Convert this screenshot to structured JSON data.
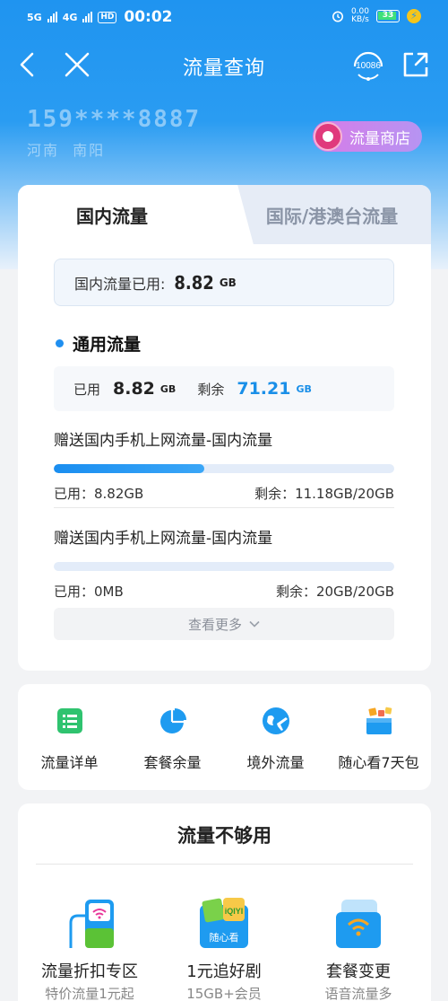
{
  "status_bar": {
    "net1": "5G",
    "net2": "4G",
    "hd": "HD",
    "time": "00:02",
    "speed_value": "0.00",
    "speed_unit": "KB/s",
    "battery": "33"
  },
  "nav": {
    "title": "流量查询",
    "service_number": "10086"
  },
  "account": {
    "phone": "159****8887",
    "region": "河南  南阳"
  },
  "shop_button": {
    "label": "流量商店"
  },
  "tabs": [
    {
      "label": "国内流量",
      "active": true
    },
    {
      "label": "国际/港澳台流量",
      "active": false
    }
  ],
  "domestic_used": {
    "label": "国内流量已用:",
    "value": "8.82",
    "unit": "GB"
  },
  "general": {
    "title": "通用流量",
    "used_label": "已用",
    "used_value": "8.82",
    "used_unit": "GB",
    "remaining_label": "剩余",
    "remaining_value": "71.21",
    "remaining_unit": "GB"
  },
  "packages": [
    {
      "name": "赠送国内手机上网流量-国内流量",
      "used": "已用：8.82GB",
      "remaining": "剩余：11.18GB/20GB",
      "progress_fraction": 0.441
    },
    {
      "name": "赠送国内手机上网流量-国内流量",
      "used": "已用：0MB",
      "remaining": "剩余：20GB/20GB",
      "progress_fraction": 0.0
    }
  ],
  "more_button": {
    "label": "查看更多"
  },
  "quick_actions": [
    {
      "label": "流量详单",
      "icon": "list-icon"
    },
    {
      "label": "套餐余量",
      "icon": "pie-chart-icon"
    },
    {
      "label": "境外流量",
      "icon": "globe-plane-icon"
    },
    {
      "label": "随心看7天包",
      "icon": "gift-box-icon"
    }
  ],
  "promo_section": {
    "title": "流量不够用",
    "items": [
      {
        "title": "流量折扣专区",
        "subtitle": "特价流量1元起",
        "icon": "wifi-phone-icon"
      },
      {
        "title": "1元追好剧",
        "subtitle": "15GB+会员",
        "icon": "video-app-icon",
        "badge": "随心看"
      },
      {
        "title": "套餐变更",
        "subtitle": "语音流量多",
        "icon": "wifi-card-icon"
      }
    ]
  },
  "colors": {
    "header_blue": "#1f94f0",
    "accent_blue": "#1a8fe8",
    "shop_gradient_start": "#d77be8"
  }
}
